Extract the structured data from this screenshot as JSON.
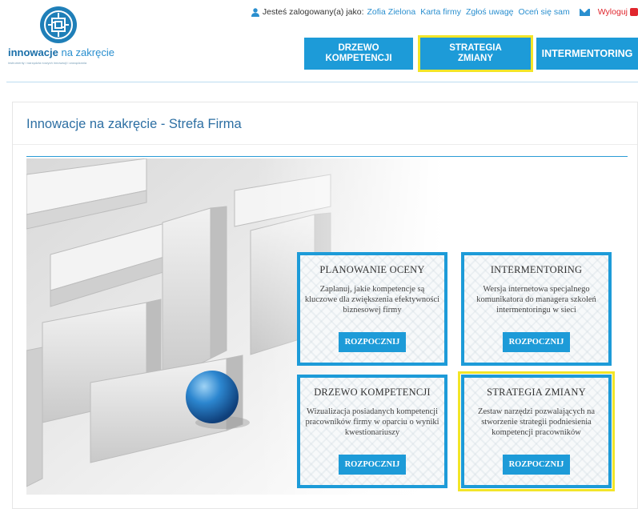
{
  "logo": {
    "brand_bold": "innowacje",
    "brand_light": " na zakręcie",
    "tagline": "instrumenty i narzędzia nowych innowacji i zarządzania"
  },
  "userbar": {
    "logged_as": "Jesteś zalogowany(a) jako:",
    "user_name": "Zofia Zielona",
    "company_card": "Karta firmy",
    "report": "Zgłoś uwagę",
    "self_assess": "Oceń się sam",
    "logout": "Wyloguj"
  },
  "nav": {
    "drzewo_line1": "DRZEWO",
    "drzewo_line2": "KOMPETENCJI",
    "strategia_line1": "STRATEGIA",
    "strategia_line2": "ZMIANY",
    "intermentoring": "INTERMENTORING"
  },
  "panel": {
    "title": "Innowacje na zakręcie - Strefa Firma"
  },
  "cards": [
    {
      "title": "PLANOWANIE OCENY",
      "description": "Zaplanuj, jakie kompetencje są kluczowe dla zwiększenia efektywności biznesowej firmy",
      "button": "ROZPOCZNIJ"
    },
    {
      "title": "INTERMENTORING",
      "description": "Wersja internetowa specjalnego komunikatora do managera szkoleń intermentoringu w sieci",
      "button": "ROZPOCZNIJ"
    },
    {
      "title": "DRZEWO KOMPETENCJI",
      "description": "Wizualizacja posiadanych kompetencji pracowników firmy w oparciu o wyniki kwestionariuszy",
      "button": "ROZPOCZNIJ"
    },
    {
      "title": "STRATEGIA ZMIANY",
      "description": "Zestaw narzędzi pozwalających na stworzenie strategii podniesienia kompetencji pracowników",
      "button": "ROZPOCZNIJ"
    }
  ],
  "colors": {
    "accent": "#1d9bd8",
    "highlight": "#f3e528",
    "logout": "#e0262d",
    "title": "#2d6fa3"
  }
}
